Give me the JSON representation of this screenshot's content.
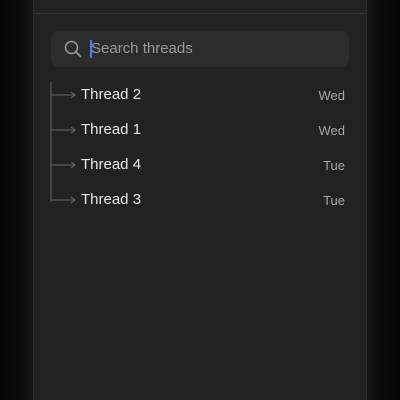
{
  "search": {
    "placeholder": "Search threads",
    "icon": "search-icon"
  },
  "threads": [
    {
      "title": "Thread 2",
      "date": "Wed"
    },
    {
      "title": "Thread 1",
      "date": "Wed"
    },
    {
      "title": "Thread 4",
      "date": "Tue"
    },
    {
      "title": "Thread 3",
      "date": "Tue"
    }
  ],
  "colors": {
    "panel_bg": "#222222",
    "search_bg": "#2c2c2c",
    "text_primary": "#e8e8e8",
    "text_secondary": "#a8a8a8",
    "caret": "#4c7dff"
  }
}
